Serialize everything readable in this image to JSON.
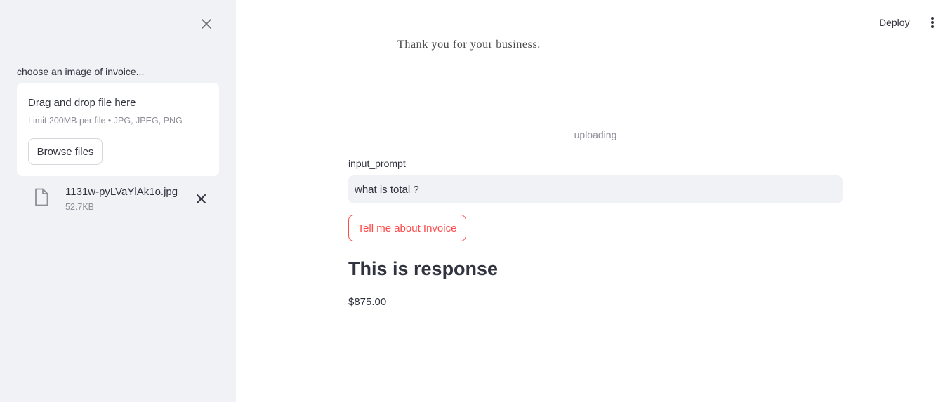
{
  "sidebar": {
    "close_icon": "close-icon",
    "uploader": {
      "label": "choose an image of invoice...",
      "drop_title": "Drag and drop file here",
      "limit_text": "Limit 200MB per file • JPG, JPEG, PNG",
      "browse_label": "Browse files"
    },
    "file": {
      "icon": "file-icon",
      "name": "1131w-pyLVaYlAk1o.jpg",
      "size": "52.7KB",
      "remove_icon": "close-icon"
    }
  },
  "header": {
    "deploy_label": "Deploy",
    "menu_icon": "kebab-menu-icon"
  },
  "main": {
    "invoice_image_text": "Thank you for your business.",
    "status_text": "uploading",
    "prompt_label": "input_prompt",
    "prompt_value": "what is total ?",
    "submit_label": "Tell me about Invoice",
    "response_heading": "This is response",
    "response_text": "$875.00"
  },
  "colors": {
    "sidebar_bg": "#f0f2f6",
    "accent": "#ff4b4b",
    "text": "#31333f",
    "muted": "#8c8e98"
  }
}
